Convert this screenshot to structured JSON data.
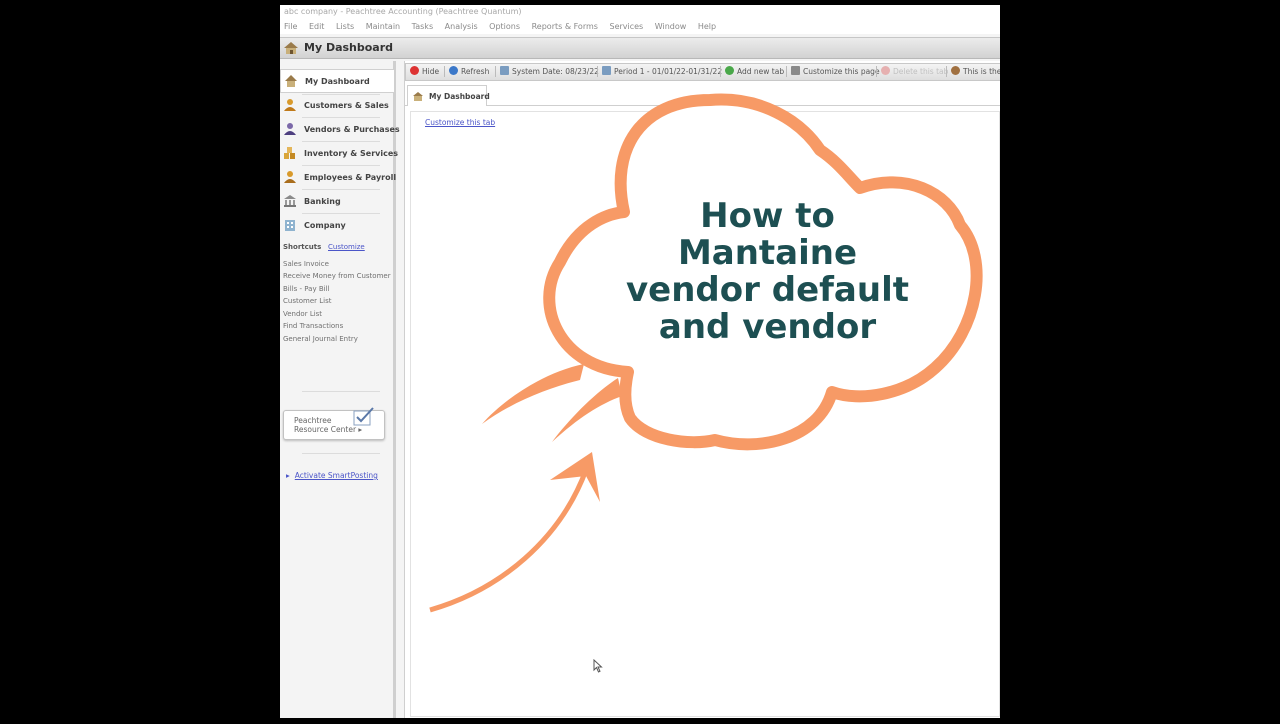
{
  "window": {
    "title": "abc company - Peachtree Accounting (Peachtree Quantum)",
    "menu": [
      "File",
      "Edit",
      "Lists",
      "Maintain",
      "Tasks",
      "Analysis",
      "Options",
      "Reports & Forms",
      "Services",
      "Window",
      "Help"
    ]
  },
  "dashboard_header": {
    "title": "My Dashboard",
    "icon": "house-icon"
  },
  "sidebar": {
    "items": [
      {
        "label": "My Dashboard",
        "icon": "house-icon",
        "active": true
      },
      {
        "label": "Customers & Sales",
        "icon": "person-icon"
      },
      {
        "label": "Vendors & Purchases",
        "icon": "person-icon"
      },
      {
        "label": "Inventory & Services",
        "icon": "boxes-icon"
      },
      {
        "label": "Employees & Payroll",
        "icon": "person-icon"
      },
      {
        "label": "Banking",
        "icon": "bank-icon"
      },
      {
        "label": "Company",
        "icon": "building-icon"
      }
    ],
    "shortcuts_heading": "Shortcuts",
    "shortcuts_customize": "Customize",
    "shortcuts": [
      "Sales Invoice",
      "Receive Money from Customer",
      "Bills - Pay Bill",
      "Customer List",
      "Vendor List",
      "Find Transactions",
      "General Journal Entry"
    ],
    "resource_center": {
      "line1": "Peachtree",
      "line2": "Resource Center ▸"
    },
    "smartposting_link": "Activate SmartPosting"
  },
  "toolbar": {
    "hide": "Hide",
    "refresh": "Refresh",
    "system_date": "System Date: 08/23/22",
    "period": "Period 1 - 01/01/22-01/31/22",
    "add_tab": "Add new tab",
    "customize_page": "Customize this page",
    "delete_tab": "Delete this tab",
    "this_is": "This is the"
  },
  "tabs": {
    "active": "My Dashboard"
  },
  "content": {
    "customize_link": "Customize this tab"
  },
  "overlay": {
    "cloud_text": [
      "How to",
      "Mantaine",
      "vendor default",
      "and vendor"
    ],
    "cloud_color": "#f79a66",
    "text_color": "#1d4f52"
  }
}
